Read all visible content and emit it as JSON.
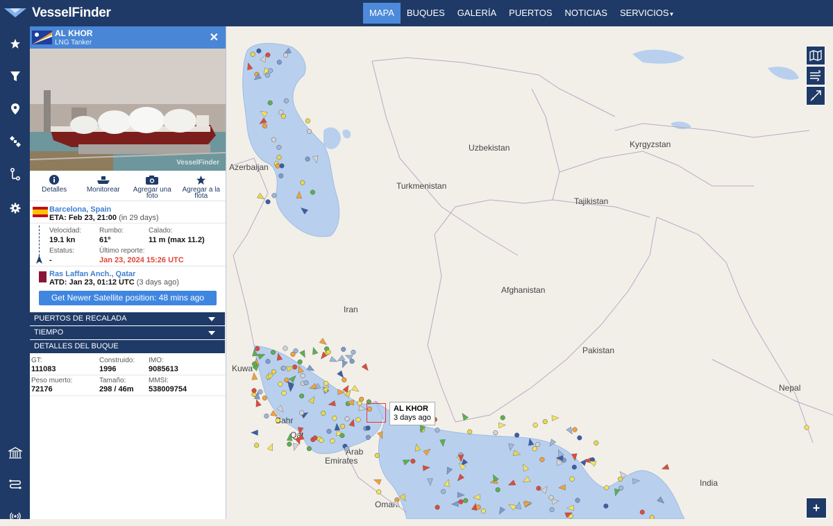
{
  "brand": {
    "name": "VesselFinder"
  },
  "nav": [
    {
      "label": "MAPA",
      "active": true
    },
    {
      "label": "BUQUES"
    },
    {
      "label": "GALERÍA"
    },
    {
      "label": "PUERTOS"
    },
    {
      "label": "NOTICIAS"
    },
    {
      "label": "SERVICIOS"
    }
  ],
  "sidebar_icons": [
    "star-icon",
    "filter-icon",
    "map-pin-icon",
    "satellite-icon",
    "route-icon",
    "gear-icon",
    "port-icon",
    "track-icon",
    "signal-icon"
  ],
  "vessel": {
    "name": "AL KHOR",
    "type": "LNG Tanker",
    "photo_watermark": "VesselFinder",
    "actions": {
      "details": "Detalles",
      "monitor": "Monitorear",
      "add_photo": "Agregar una foto",
      "add_fleet": "Agregar a la flota"
    },
    "destination": {
      "port": "Barcelona, Spain",
      "eta_label": "ETA: Feb 23, 21:00",
      "eta_rel": "(in 29 days)"
    },
    "speed": {
      "label": "Velocidad:",
      "value": "19.1 kn"
    },
    "course": {
      "label": "Rumbo:",
      "value": "61º"
    },
    "draught": {
      "label": "Calado:",
      "value": "11 m (max 11.2)"
    },
    "status": {
      "label": "Estatus:",
      "value": "-"
    },
    "last_report": {
      "label": "Último reporte:",
      "value": "Jan 23, 2024 15:26 UTC"
    },
    "origin": {
      "port": "Ras Laffan Anch., Qatar",
      "atd_label": "ATD: Jan 23, 01:12 UTC",
      "atd_rel": "(3 days ago)"
    },
    "sat_button": "Get Newer Satellite position: 48 mins ago",
    "sections": {
      "ports": "PUERTOS DE RECALADA",
      "weather": "TIEMPO",
      "details": "DETALLES DEL BUQUE"
    },
    "details": {
      "gt": {
        "label": "GT:",
        "value": "111083"
      },
      "built": {
        "label": "Construido:",
        "value": "1996"
      },
      "imo": {
        "label": "IMO:",
        "value": "9085613"
      },
      "dwt": {
        "label": "Peso muerto:",
        "value": "72176"
      },
      "size": {
        "label": "Tamaño:",
        "value": "298 / 46m"
      },
      "mmsi": {
        "label": "MMSI:",
        "value": "538009754"
      }
    },
    "colors": {
      "header": "#4a86d6",
      "last_report": "#e0463a",
      "link": "#3f7fd2"
    }
  },
  "map": {
    "labels": {
      "azerbaijan": "Azerbaijan",
      "uzbekistan": "Uzbekistan",
      "kyrgyzstan": "Kyrgyzstan",
      "turkmenistan": "Turkmenistan",
      "tajikistan": "Tajikistan",
      "afghanistan": "Afghanistan",
      "iran": "Iran",
      "pakistan": "Pakistan",
      "nepal": "Nepal",
      "india": "India",
      "oman": "Oman",
      "kuwait": "Kuwa",
      "bahrain": "Bahr",
      "qatar": "Qat",
      "emirates_a": "Arab",
      "emirates_b": "Emirates"
    },
    "tooltip": {
      "name": "AL KHOR",
      "time": "3 days ago"
    },
    "zoom_in": "+",
    "controls": [
      "map-layers-icon",
      "weather-icon",
      "measure-icon"
    ],
    "colors": {
      "water": "#b8d0ee",
      "land": "#f2efe9"
    }
  }
}
